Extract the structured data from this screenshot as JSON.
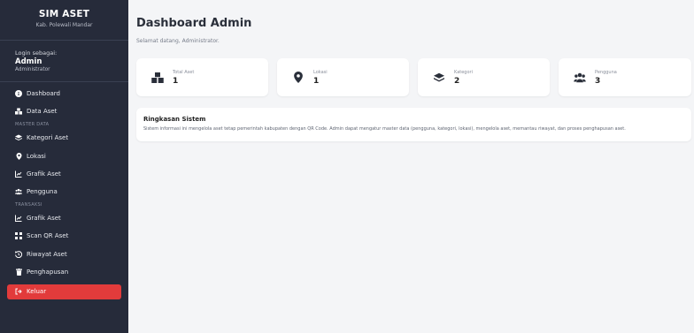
{
  "brand": {
    "title": "SIM ASET",
    "subtitle": "Kab. Polewali Mandar"
  },
  "login": {
    "label": "Login sebagai:",
    "user": "Admin",
    "role": "Administrator"
  },
  "sidebar": {
    "items": [
      {
        "label": "Dashboard",
        "icon": "info-circle-icon"
      },
      {
        "label": "Data Aset",
        "icon": "boxes-icon"
      },
      {
        "section": "MASTER DATA"
      },
      {
        "label": "Kategori Aset",
        "icon": "layers-icon"
      },
      {
        "label": "Lokasi",
        "icon": "map-pin-icon"
      },
      {
        "label": "Grafik Aset",
        "icon": "line-chart-icon"
      },
      {
        "label": "Pengguna",
        "icon": "users-icon"
      },
      {
        "section": "TRANSAKSI"
      },
      {
        "label": "Grafik Aset",
        "icon": "line-chart-icon"
      },
      {
        "label": "Scan QR Aset",
        "icon": "qr-code-icon"
      },
      {
        "label": "Riwayat Aset",
        "icon": "history-icon"
      },
      {
        "label": "Penghapusan",
        "icon": "trash-icon"
      }
    ],
    "logout": {
      "label": "Keluar",
      "icon": "logout-icon",
      "color": "#e23b3b"
    }
  },
  "page": {
    "title": "Dashboard Admin",
    "subtitle": "Selamat datang, Administrator."
  },
  "stats": [
    {
      "label": "Total Aset",
      "value": "1",
      "icon": "boxes-icon"
    },
    {
      "label": "Lokasi",
      "value": "1",
      "icon": "map-pin-icon"
    },
    {
      "label": "Kategori",
      "value": "2",
      "icon": "layers-icon"
    },
    {
      "label": "Pengguna",
      "value": "3",
      "icon": "users-icon"
    }
  ],
  "summary": {
    "title": "Ringkasan Sistem",
    "text": "Sistem informasi ini mengelola aset tetap pemerintah kabupaten dengan QR Code. Admin dapat mengatur master data (pengguna, kategori, lokasi), mengelola aset, memantau riwayat, dan proses penghapusan aset."
  },
  "colors": {
    "sidebar": "#262b3a",
    "accent": "#e23b3b",
    "background": "#f4f5f7"
  }
}
